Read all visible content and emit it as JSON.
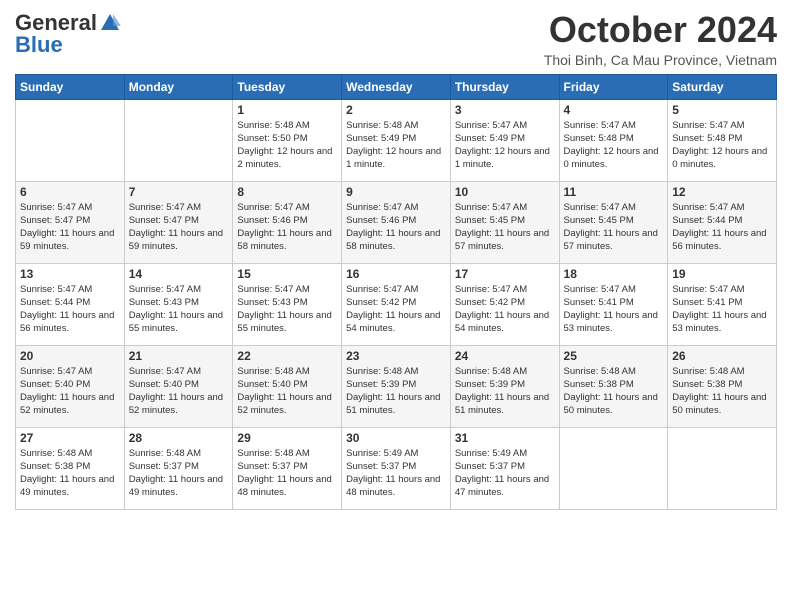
{
  "header": {
    "logo_general": "General",
    "logo_blue": "Blue",
    "month_title": "October 2024",
    "subtitle": "Thoi Binh, Ca Mau Province, Vietnam"
  },
  "days_of_week": [
    "Sunday",
    "Monday",
    "Tuesday",
    "Wednesday",
    "Thursday",
    "Friday",
    "Saturday"
  ],
  "weeks": [
    [
      {
        "day": "",
        "sunrise": "",
        "sunset": "",
        "daylight": ""
      },
      {
        "day": "",
        "sunrise": "",
        "sunset": "",
        "daylight": ""
      },
      {
        "day": "1",
        "sunrise": "Sunrise: 5:48 AM",
        "sunset": "Sunset: 5:50 PM",
        "daylight": "Daylight: 12 hours and 2 minutes."
      },
      {
        "day": "2",
        "sunrise": "Sunrise: 5:48 AM",
        "sunset": "Sunset: 5:49 PM",
        "daylight": "Daylight: 12 hours and 1 minute."
      },
      {
        "day": "3",
        "sunrise": "Sunrise: 5:47 AM",
        "sunset": "Sunset: 5:49 PM",
        "daylight": "Daylight: 12 hours and 1 minute."
      },
      {
        "day": "4",
        "sunrise": "Sunrise: 5:47 AM",
        "sunset": "Sunset: 5:48 PM",
        "daylight": "Daylight: 12 hours and 0 minutes."
      },
      {
        "day": "5",
        "sunrise": "Sunrise: 5:47 AM",
        "sunset": "Sunset: 5:48 PM",
        "daylight": "Daylight: 12 hours and 0 minutes."
      }
    ],
    [
      {
        "day": "6",
        "sunrise": "Sunrise: 5:47 AM",
        "sunset": "Sunset: 5:47 PM",
        "daylight": "Daylight: 11 hours and 59 minutes."
      },
      {
        "day": "7",
        "sunrise": "Sunrise: 5:47 AM",
        "sunset": "Sunset: 5:47 PM",
        "daylight": "Daylight: 11 hours and 59 minutes."
      },
      {
        "day": "8",
        "sunrise": "Sunrise: 5:47 AM",
        "sunset": "Sunset: 5:46 PM",
        "daylight": "Daylight: 11 hours and 58 minutes."
      },
      {
        "day": "9",
        "sunrise": "Sunrise: 5:47 AM",
        "sunset": "Sunset: 5:46 PM",
        "daylight": "Daylight: 11 hours and 58 minutes."
      },
      {
        "day": "10",
        "sunrise": "Sunrise: 5:47 AM",
        "sunset": "Sunset: 5:45 PM",
        "daylight": "Daylight: 11 hours and 57 minutes."
      },
      {
        "day": "11",
        "sunrise": "Sunrise: 5:47 AM",
        "sunset": "Sunset: 5:45 PM",
        "daylight": "Daylight: 11 hours and 57 minutes."
      },
      {
        "day": "12",
        "sunrise": "Sunrise: 5:47 AM",
        "sunset": "Sunset: 5:44 PM",
        "daylight": "Daylight: 11 hours and 56 minutes."
      }
    ],
    [
      {
        "day": "13",
        "sunrise": "Sunrise: 5:47 AM",
        "sunset": "Sunset: 5:44 PM",
        "daylight": "Daylight: 11 hours and 56 minutes."
      },
      {
        "day": "14",
        "sunrise": "Sunrise: 5:47 AM",
        "sunset": "Sunset: 5:43 PM",
        "daylight": "Daylight: 11 hours and 55 minutes."
      },
      {
        "day": "15",
        "sunrise": "Sunrise: 5:47 AM",
        "sunset": "Sunset: 5:43 PM",
        "daylight": "Daylight: 11 hours and 55 minutes."
      },
      {
        "day": "16",
        "sunrise": "Sunrise: 5:47 AM",
        "sunset": "Sunset: 5:42 PM",
        "daylight": "Daylight: 11 hours and 54 minutes."
      },
      {
        "day": "17",
        "sunrise": "Sunrise: 5:47 AM",
        "sunset": "Sunset: 5:42 PM",
        "daylight": "Daylight: 11 hours and 54 minutes."
      },
      {
        "day": "18",
        "sunrise": "Sunrise: 5:47 AM",
        "sunset": "Sunset: 5:41 PM",
        "daylight": "Daylight: 11 hours and 53 minutes."
      },
      {
        "day": "19",
        "sunrise": "Sunrise: 5:47 AM",
        "sunset": "Sunset: 5:41 PM",
        "daylight": "Daylight: 11 hours and 53 minutes."
      }
    ],
    [
      {
        "day": "20",
        "sunrise": "Sunrise: 5:47 AM",
        "sunset": "Sunset: 5:40 PM",
        "daylight": "Daylight: 11 hours and 52 minutes."
      },
      {
        "day": "21",
        "sunrise": "Sunrise: 5:47 AM",
        "sunset": "Sunset: 5:40 PM",
        "daylight": "Daylight: 11 hours and 52 minutes."
      },
      {
        "day": "22",
        "sunrise": "Sunrise: 5:48 AM",
        "sunset": "Sunset: 5:40 PM",
        "daylight": "Daylight: 11 hours and 52 minutes."
      },
      {
        "day": "23",
        "sunrise": "Sunrise: 5:48 AM",
        "sunset": "Sunset: 5:39 PM",
        "daylight": "Daylight: 11 hours and 51 minutes."
      },
      {
        "day": "24",
        "sunrise": "Sunrise: 5:48 AM",
        "sunset": "Sunset: 5:39 PM",
        "daylight": "Daylight: 11 hours and 51 minutes."
      },
      {
        "day": "25",
        "sunrise": "Sunrise: 5:48 AM",
        "sunset": "Sunset: 5:38 PM",
        "daylight": "Daylight: 11 hours and 50 minutes."
      },
      {
        "day": "26",
        "sunrise": "Sunrise: 5:48 AM",
        "sunset": "Sunset: 5:38 PM",
        "daylight": "Daylight: 11 hours and 50 minutes."
      }
    ],
    [
      {
        "day": "27",
        "sunrise": "Sunrise: 5:48 AM",
        "sunset": "Sunset: 5:38 PM",
        "daylight": "Daylight: 11 hours and 49 minutes."
      },
      {
        "day": "28",
        "sunrise": "Sunrise: 5:48 AM",
        "sunset": "Sunset: 5:37 PM",
        "daylight": "Daylight: 11 hours and 49 minutes."
      },
      {
        "day": "29",
        "sunrise": "Sunrise: 5:48 AM",
        "sunset": "Sunset: 5:37 PM",
        "daylight": "Daylight: 11 hours and 48 minutes."
      },
      {
        "day": "30",
        "sunrise": "Sunrise: 5:49 AM",
        "sunset": "Sunset: 5:37 PM",
        "daylight": "Daylight: 11 hours and 48 minutes."
      },
      {
        "day": "31",
        "sunrise": "Sunrise: 5:49 AM",
        "sunset": "Sunset: 5:37 PM",
        "daylight": "Daylight: 11 hours and 47 minutes."
      },
      {
        "day": "",
        "sunrise": "",
        "sunset": "",
        "daylight": ""
      },
      {
        "day": "",
        "sunrise": "",
        "sunset": "",
        "daylight": ""
      }
    ]
  ]
}
